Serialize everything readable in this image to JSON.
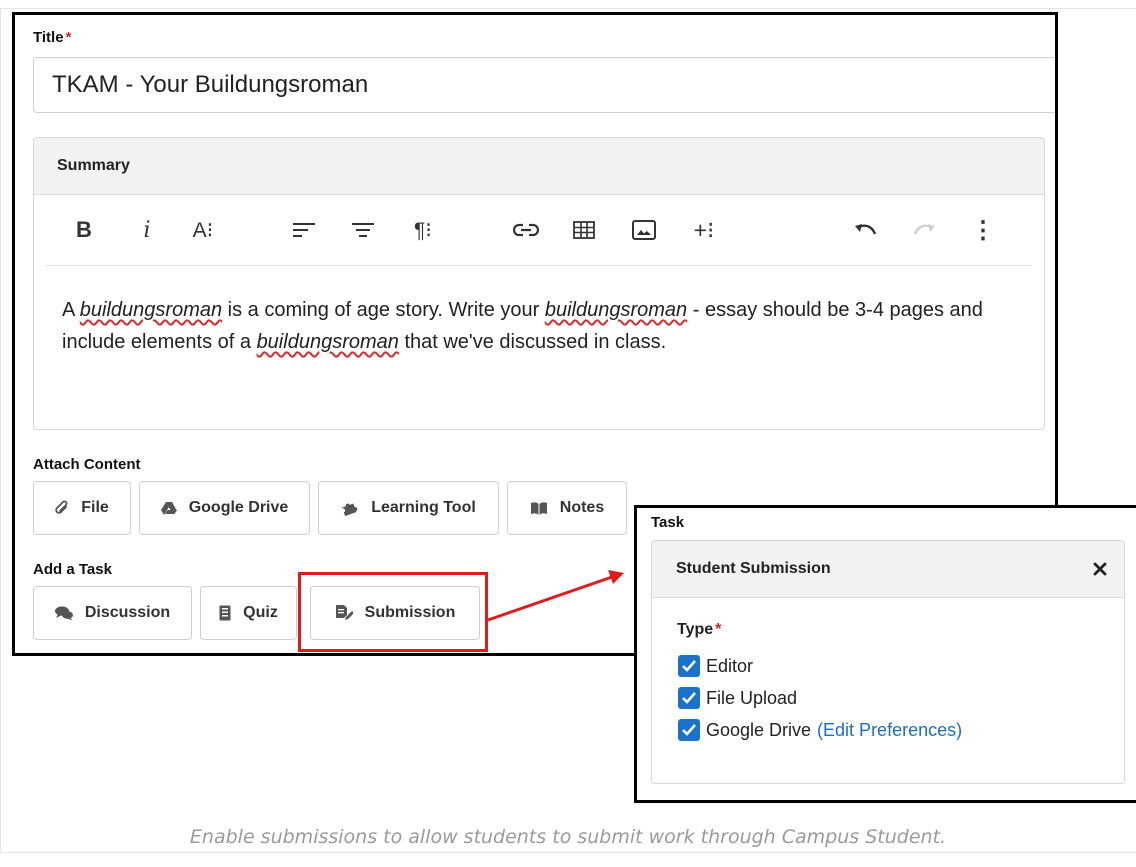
{
  "title_field": {
    "label": "Title",
    "required_mark": "*",
    "value": "TKAM - Your Buildungsroman"
  },
  "summary": {
    "header": "Summary",
    "toolbar": {
      "bold": "B",
      "italic": "i",
      "font_size": "A⁝",
      "paragraph": "¶⁝",
      "insert": "+⁝",
      "more": "⋮"
    },
    "body": {
      "p1": "A ",
      "em1": "buildungsroman",
      "p2": " is a coming of age story. Write your ",
      "em2": "buildungsroman",
      "p3": " - essay should be 3-4 pages and include elements of a ",
      "em3": "buildungsroman",
      "p4": " that we've discussed in class."
    }
  },
  "attach_content": {
    "label": "Attach Content",
    "buttons": [
      {
        "label": "File",
        "icon": "paperclip-icon"
      },
      {
        "label": "Google Drive",
        "icon": "google-drive-icon"
      },
      {
        "label": "Learning Tool",
        "icon": "puzzle-icon"
      },
      {
        "label": "Notes",
        "icon": "book-icon"
      }
    ]
  },
  "add_task": {
    "label": "Add a Task",
    "buttons": [
      {
        "label": "Discussion",
        "icon": "comments-icon"
      },
      {
        "label": "Quiz",
        "icon": "list-icon"
      },
      {
        "label": "Submission",
        "icon": "submission-icon"
      }
    ]
  },
  "task_panel": {
    "label": "Task",
    "card_title": "Student Submission",
    "close": "×",
    "type_label": "Type",
    "required_mark": "*",
    "options": [
      {
        "label": "Editor",
        "checked": true
      },
      {
        "label": "File Upload",
        "checked": true
      },
      {
        "label": "Google Drive",
        "checked": true,
        "link": "(Edit Preferences)"
      }
    ]
  },
  "caption": "Enable submissions to allow students to submit work through Campus Student.",
  "colors": {
    "callout_red": "#e01b1b",
    "checkbox_blue": "#1a73c9",
    "link_blue": "#1a6fc2",
    "required_red": "#c62828"
  }
}
